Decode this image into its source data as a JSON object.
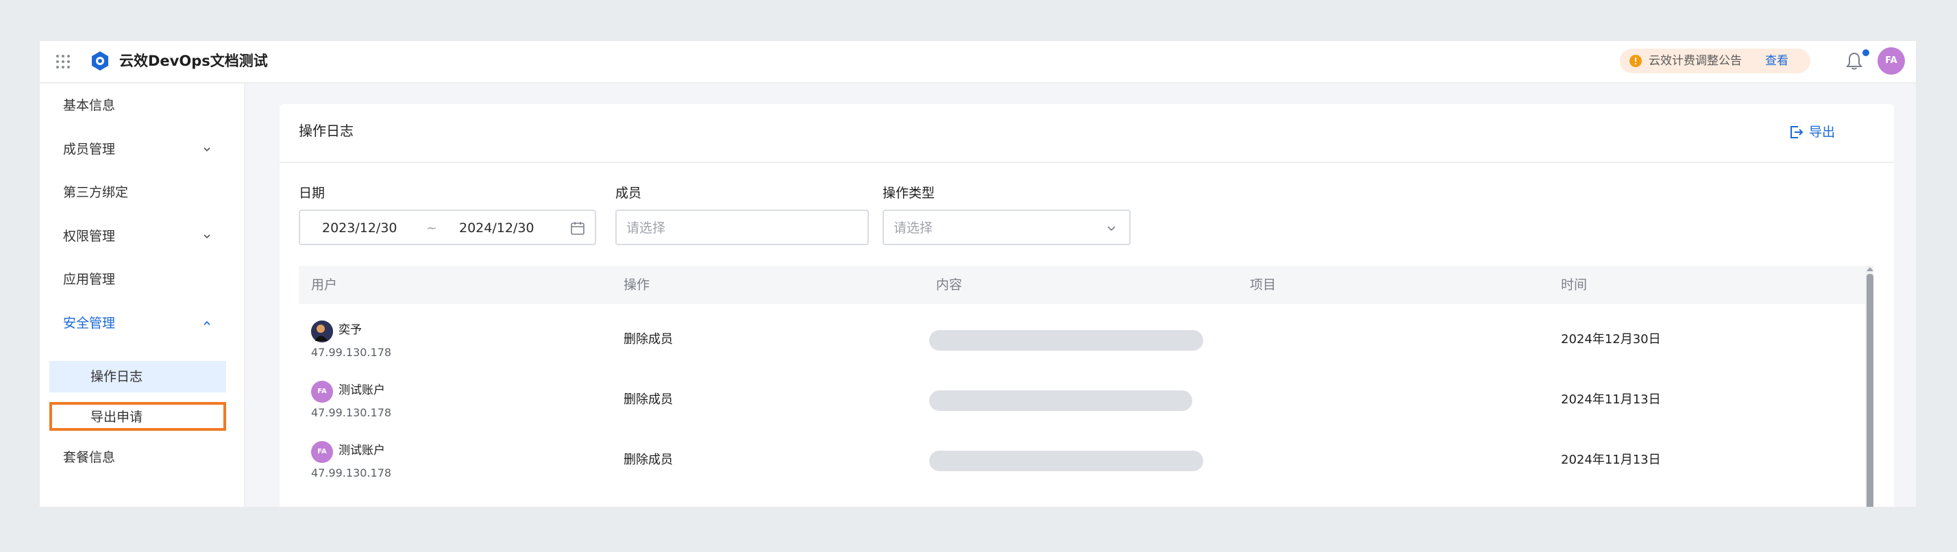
{
  "app": {
    "title": "云效DevOps文档测试",
    "notice_text": "云效计费调整公告",
    "notice_link": "查看",
    "user_initials": "FA",
    "accent_color": "#1b69d6",
    "highlight_color": "#f07a25",
    "avatar_color": "#c07ed6"
  },
  "sidebar": {
    "items": [
      {
        "label": "基本信息"
      },
      {
        "label": "成员管理"
      },
      {
        "label": "第三方绑定"
      },
      {
        "label": "权限管理"
      },
      {
        "label": "应用管理"
      },
      {
        "label": "安全管理"
      },
      {
        "label": "操作日志"
      },
      {
        "label": "导出申请"
      },
      {
        "label": "套餐信息"
      }
    ]
  },
  "page": {
    "title": "操作日志",
    "export_label": "导出"
  },
  "filters": {
    "date_label": "日期",
    "date_start": "2023/12/30",
    "date_sep": "~",
    "date_end": "2024/12/30",
    "member_label": "成员",
    "member_placeholder": "请选择",
    "optype_label": "操作类型",
    "optype_placeholder": "请选择"
  },
  "table": {
    "columns": [
      "用户",
      "操作",
      "内容",
      "项目",
      "时间"
    ],
    "rows": [
      {
        "user": "奕予",
        "ip": "47.99.130.178",
        "action": "删除成员",
        "project": "",
        "time": "2024年12月30日"
      },
      {
        "user": "测试账户",
        "ip": "47.99.130.178",
        "action": "删除成员",
        "project": "",
        "time": "2024年11月13日",
        "initials": "FA"
      },
      {
        "user": "测试账户",
        "ip": "47.99.130.178",
        "action": "删除成员",
        "project": "",
        "time": "2024年11月13日",
        "initials": "FA"
      }
    ]
  }
}
